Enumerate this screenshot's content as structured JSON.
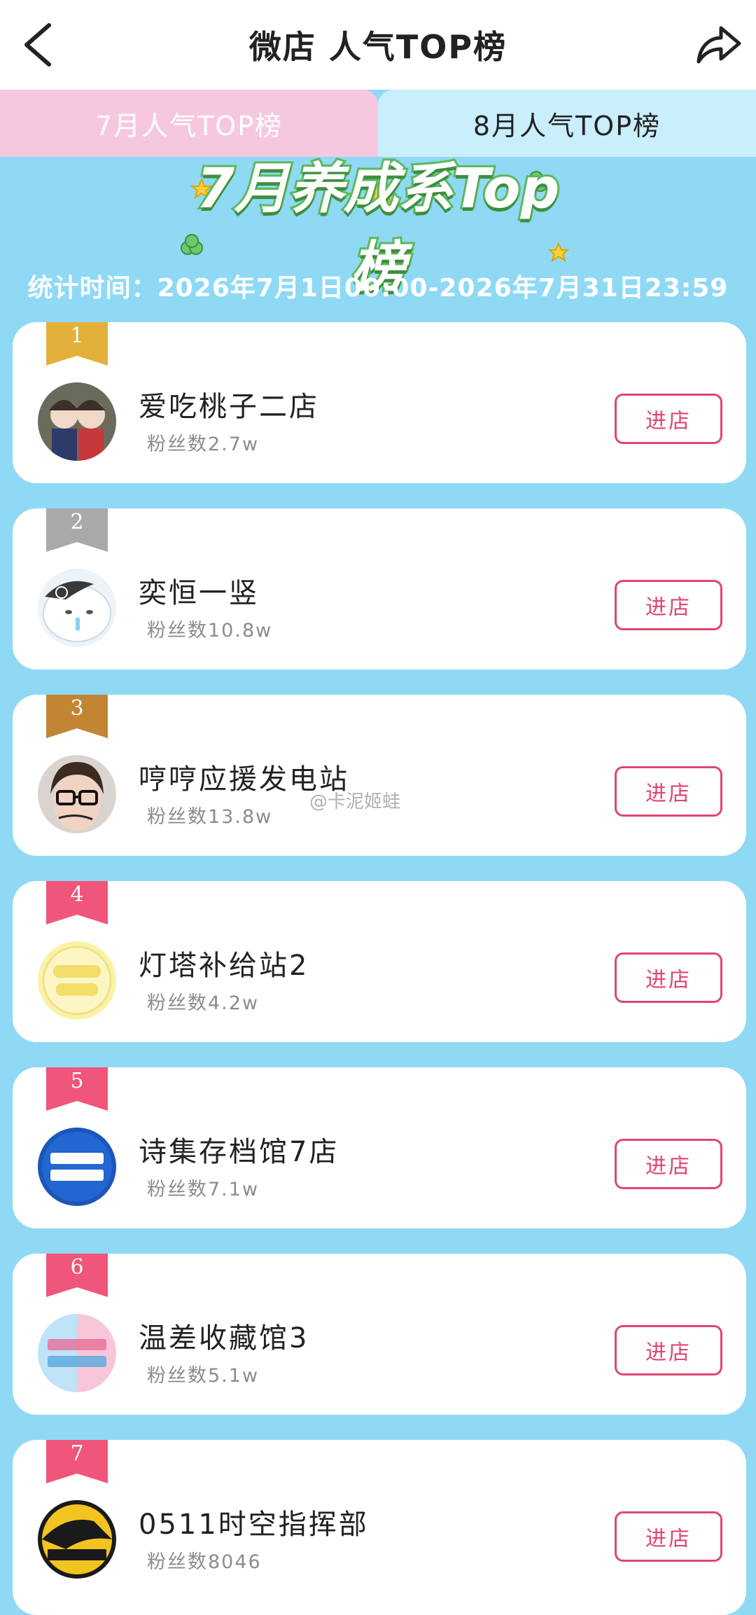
{
  "header": {
    "title": "微店 人气TOP榜"
  },
  "tabs": [
    {
      "label": "7月人气TOP榜",
      "active": true
    },
    {
      "label": "8月人气TOP榜",
      "active": false
    }
  ],
  "banner": {
    "logo_text": "7月养成系Top榜",
    "period": "统计时间：2026年7月1日00:00-2026年7月31日23:59"
  },
  "button_label": "进店",
  "shops": [
    {
      "rank": "1",
      "name": "爱吃桃子二店",
      "fans": "粉丝数2.7w",
      "ribbon_color": "#e3b13a"
    },
    {
      "rank": "2",
      "name": "奕恒一竖",
      "fans": "粉丝数10.8w",
      "ribbon_color": "#a9a9a9"
    },
    {
      "rank": "3",
      "name": "哼哼应援发电站",
      "fans": "粉丝数13.8w",
      "ribbon_color": "#c38433"
    },
    {
      "rank": "4",
      "name": "灯塔补给站2",
      "fans": "粉丝数4.2w",
      "ribbon_color": "#f0557a"
    },
    {
      "rank": "5",
      "name": "诗集存档馆7店",
      "fans": "粉丝数7.1w",
      "ribbon_color": "#f0557a"
    },
    {
      "rank": "6",
      "name": "温差收藏馆3",
      "fans": "粉丝数5.1w",
      "ribbon_color": "#f0557a"
    },
    {
      "rank": "7",
      "name": "0511时空指挥部",
      "fans": "粉丝数8046",
      "ribbon_color": "#f0557a"
    }
  ],
  "watermark": "@卡泥姬蛙"
}
